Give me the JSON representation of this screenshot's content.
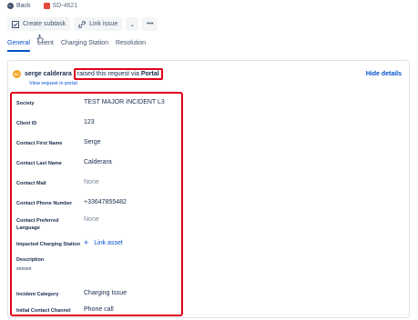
{
  "nav": {
    "back_label": "Back",
    "issue_key": "SD-4621"
  },
  "toolbar": {
    "create_subtask": "Create subtask",
    "link_issue": "Link issue",
    "more": "•••"
  },
  "tabs": [
    "General",
    "Client",
    "Charging Station",
    "Resolution"
  ],
  "request": {
    "avatar_initials": "SC",
    "reporter": "serge calderara",
    "raised_text": "raised this request via",
    "channel": "Portal",
    "view_link": "View request in portal",
    "hide_details": "Hide details"
  },
  "fields": [
    {
      "label": "Society",
      "value": "TEST MAJOR INCIDENT L3"
    },
    {
      "label": "Client ID",
      "value": "123"
    },
    {
      "label": "Contact First Name",
      "value": "Serge"
    },
    {
      "label": "Contact Last Name",
      "value": "Calderara"
    },
    {
      "label": "Contact Mail",
      "value": "None"
    },
    {
      "label": "Contact Phone Number",
      "value": "+33647855482"
    },
    {
      "label": "Contact Preferred Language",
      "value": "None"
    },
    {
      "label": "Impacted Charging Station",
      "value": "Link asset"
    },
    {
      "label": "Incident Category",
      "value": "Charging Issue"
    },
    {
      "label": "Initial Contact Channel",
      "value": "Phone call"
    }
  ],
  "description": {
    "label": "Description",
    "value": "xxxxxx"
  },
  "colors": {
    "accent": "#0052cc",
    "highlight": "#e0001b",
    "avatar": "#f5a623",
    "issue_icon": "#e5493a"
  }
}
